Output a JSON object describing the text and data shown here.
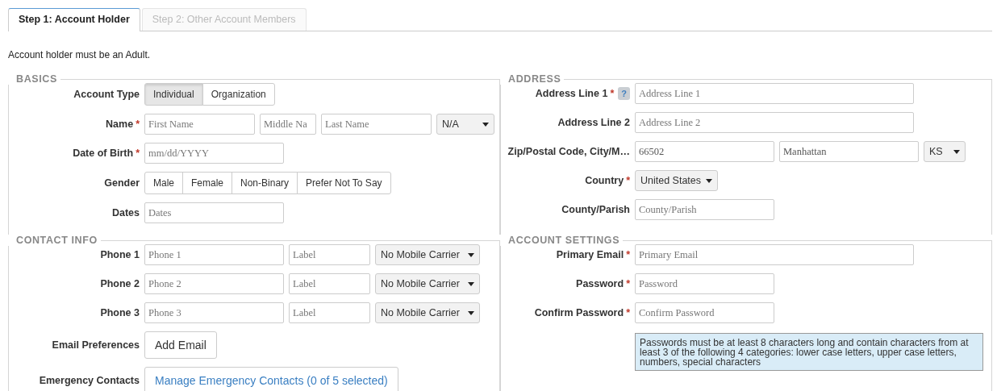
{
  "tabs": [
    {
      "label": "Step 1: Account Holder",
      "selected": true
    },
    {
      "label": "Step 2: Other Account Members",
      "selected": false
    }
  ],
  "notice": "Account holder must be an Adult.",
  "sections": [
    {
      "title": "BASICS",
      "rows": [
        {
          "label": "Account Type",
          "controls": [
            {
              "kind": "segmented",
              "options": [
                {
                  "label": "Individual",
                  "selected": true
                },
                {
                  "label": "Organization",
                  "selected": false
                }
              ]
            }
          ]
        },
        {
          "label": "Name",
          "asterisk": "*",
          "controls": [
            {
              "kind": "input",
              "placeholder": "First Name"
            },
            {
              "kind": "input",
              "placeholder": "Middle Na"
            },
            {
              "kind": "input",
              "placeholder": "Last Name"
            },
            {
              "kind": "select",
              "value": "N/A"
            }
          ]
        },
        {
          "label": "Date of Birth",
          "asterisk": "*",
          "controls": [
            {
              "kind": "input",
              "placeholder": "mm/dd/YYYY"
            }
          ]
        },
        {
          "label": "Gender",
          "controls": [
            {
              "kind": "segmented",
              "options": [
                {
                  "label": "Male",
                  "selected": false
                },
                {
                  "label": "Female",
                  "selected": false
                },
                {
                  "label": "Non-Binary",
                  "selected": false
                },
                {
                  "label": "Prefer Not To Say",
                  "selected": false
                }
              ]
            }
          ]
        },
        {
          "label": "Dates",
          "controls": [
            {
              "kind": "input",
              "placeholder": "Dates"
            }
          ]
        }
      ]
    },
    {
      "title": "ADDRESS",
      "rows": [
        {
          "label": "Address Line 1",
          "asterisk": "*",
          "help": "?",
          "controls": [
            {
              "kind": "input",
              "placeholder": "Address Line 1"
            }
          ]
        },
        {
          "label": "Address Line 2",
          "controls": [
            {
              "kind": "input",
              "placeholder": "Address Line 2"
            }
          ]
        },
        {
          "label": "Zip/Postal Code, City/M…",
          "controls": [
            {
              "kind": "input",
              "value": "66502"
            },
            {
              "kind": "input",
              "value": "Manhattan"
            },
            {
              "kind": "select",
              "value": "KS"
            }
          ]
        },
        {
          "label": "Country",
          "asterisk": "*",
          "controls": [
            {
              "kind": "select",
              "value": "United States"
            }
          ]
        },
        {
          "label": "County/Parish",
          "controls": [
            {
              "kind": "input",
              "placeholder": "County/Parish"
            }
          ]
        }
      ]
    },
    {
      "title": "CONTACT INFO",
      "rows": [
        {
          "label": "Phone 1",
          "controls": [
            {
              "kind": "input",
              "placeholder": "Phone 1"
            },
            {
              "kind": "input",
              "placeholder": "Label"
            },
            {
              "kind": "select",
              "value": "No Mobile Carrier"
            }
          ]
        },
        {
          "label": "Phone 2",
          "controls": [
            {
              "kind": "input",
              "placeholder": "Phone 2"
            },
            {
              "kind": "input",
              "placeholder": "Label"
            },
            {
              "kind": "select",
              "value": "No Mobile Carrier"
            }
          ]
        },
        {
          "label": "Phone 3",
          "controls": [
            {
              "kind": "input",
              "placeholder": "Phone 3"
            },
            {
              "kind": "input",
              "placeholder": "Label"
            },
            {
              "kind": "select",
              "value": "No Mobile Carrier"
            }
          ]
        },
        {
          "label": "Email Preferences",
          "controls": [
            {
              "kind": "button",
              "label": "Add Email"
            }
          ]
        },
        {
          "label": "Emergency Contacts",
          "controls": [
            {
              "kind": "link_button",
              "label": "Manage Emergency Contacts (0 of 5 selected)"
            }
          ]
        }
      ]
    },
    {
      "title": "ACCOUNT SETTINGS",
      "rows": [
        {
          "label": "Primary Email",
          "asterisk": "*",
          "controls": [
            {
              "kind": "input",
              "placeholder": "Primary Email"
            }
          ]
        },
        {
          "label": "Password",
          "asterisk": "*",
          "controls": [
            {
              "kind": "input",
              "placeholder": "Password"
            }
          ]
        },
        {
          "label": "Confirm Password",
          "asterisk": "*",
          "controls": [
            {
              "kind": "input",
              "placeholder": "Confirm Password"
            }
          ]
        },
        {
          "controls": [
            {
              "kind": "note",
              "text": "Passwords must be at least 8 characters long and contain characters from at least 3 of the following 4 categories: lower case letters, upper case letters, numbers, special characters"
            }
          ]
        }
      ]
    }
  ]
}
